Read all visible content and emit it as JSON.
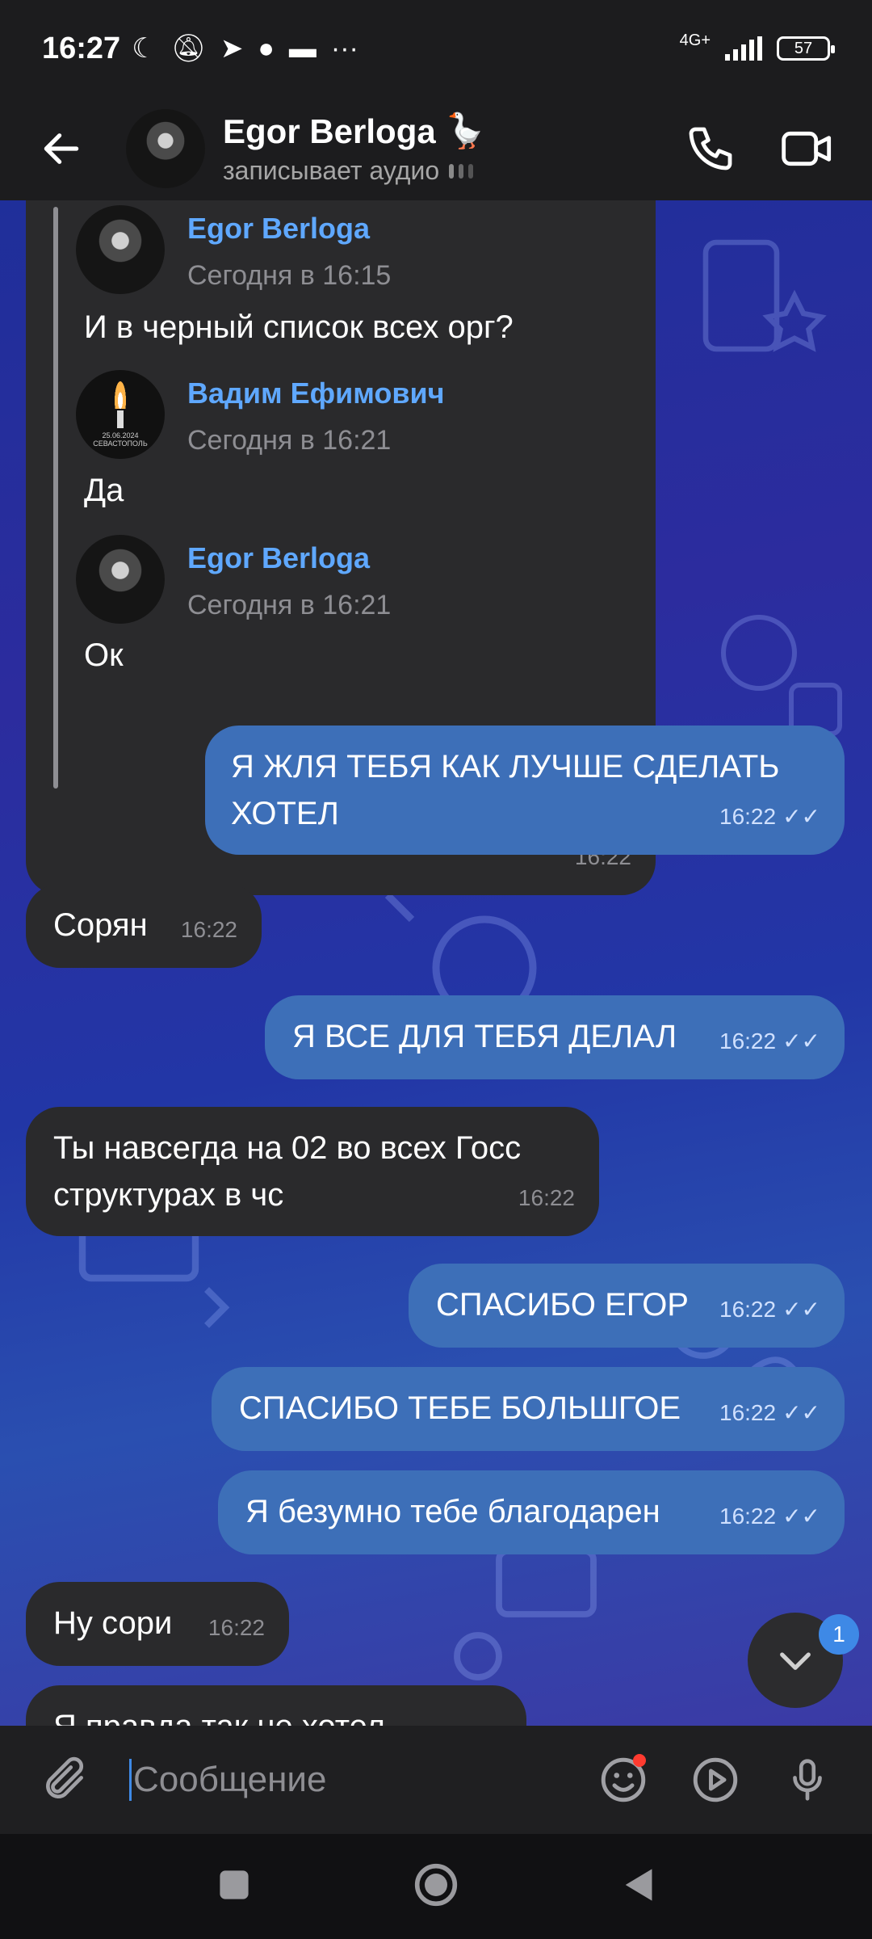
{
  "status_bar": {
    "time": "16:27",
    "network": "4G+",
    "battery": "57"
  },
  "header": {
    "contact_name": "Egor Berloga",
    "name_emoji": "🪿",
    "status": "записывает аудио"
  },
  "quoted": {
    "items": [
      {
        "author": "Egor Berloga",
        "date": "Сегодня в 16:15",
        "text": "И в черный список всех орг?"
      },
      {
        "author": "Вадим Ефимович",
        "date": "Сегодня в 16:21",
        "text": "Да",
        "avatar_caption": "25.06.2024 СЕВАСТОПОЛЬ"
      },
      {
        "author": "Egor Berloga",
        "date": "Сегодня в 16:21",
        "text": "Ок"
      }
    ],
    "time": "16:22"
  },
  "messages": [
    {
      "dir": "out",
      "text_line1": "Я ЖЛЯ ТЕБЯ КАК ЛУЧШЕ СДЕЛАТЬ",
      "text_line2": "ХОТЕЛ",
      "time": "16:22"
    },
    {
      "dir": "in",
      "text": "Сорян",
      "time": "16:22"
    },
    {
      "dir": "out",
      "text": "Я ВСЕ ДЛЯ ТЕБЯ ДЕЛАЛ",
      "time": "16:22"
    },
    {
      "dir": "in",
      "text_line1": "Ты навсегда на 02 во всех Госс",
      "text_line2": "структурах в чс",
      "time": "16:22"
    },
    {
      "dir": "out",
      "text": "СПАСИБО ЕГОР",
      "time": "16:22"
    },
    {
      "dir": "out",
      "text": "СПАСИБО ТЕБЕ БОЛЬШГОЕ",
      "time": "16:22"
    },
    {
      "dir": "out",
      "text": "Я безумно тебе благодарен",
      "time": "16:22"
    },
    {
      "dir": "in",
      "text": "Ну сори",
      "time": "16:22"
    },
    {
      "dir": "in",
      "text": "Я правда так не хотел"
    }
  ],
  "scroll_badge": "1",
  "composer": {
    "placeholder": "Сообщение"
  },
  "icons": {
    "back": "arrow-left-icon",
    "call": "phone-icon",
    "video": "video-camera-icon",
    "attach": "paperclip-icon",
    "emoji": "emoji-icon",
    "video_message": "play-circle-icon",
    "mic": "microphone-icon"
  },
  "colors": {
    "incoming_bubble": "#2a2a2c",
    "outgoing_bubble": "#3d6fb8",
    "link_name": "#5fa8ff",
    "badge": "#3e89e6"
  }
}
